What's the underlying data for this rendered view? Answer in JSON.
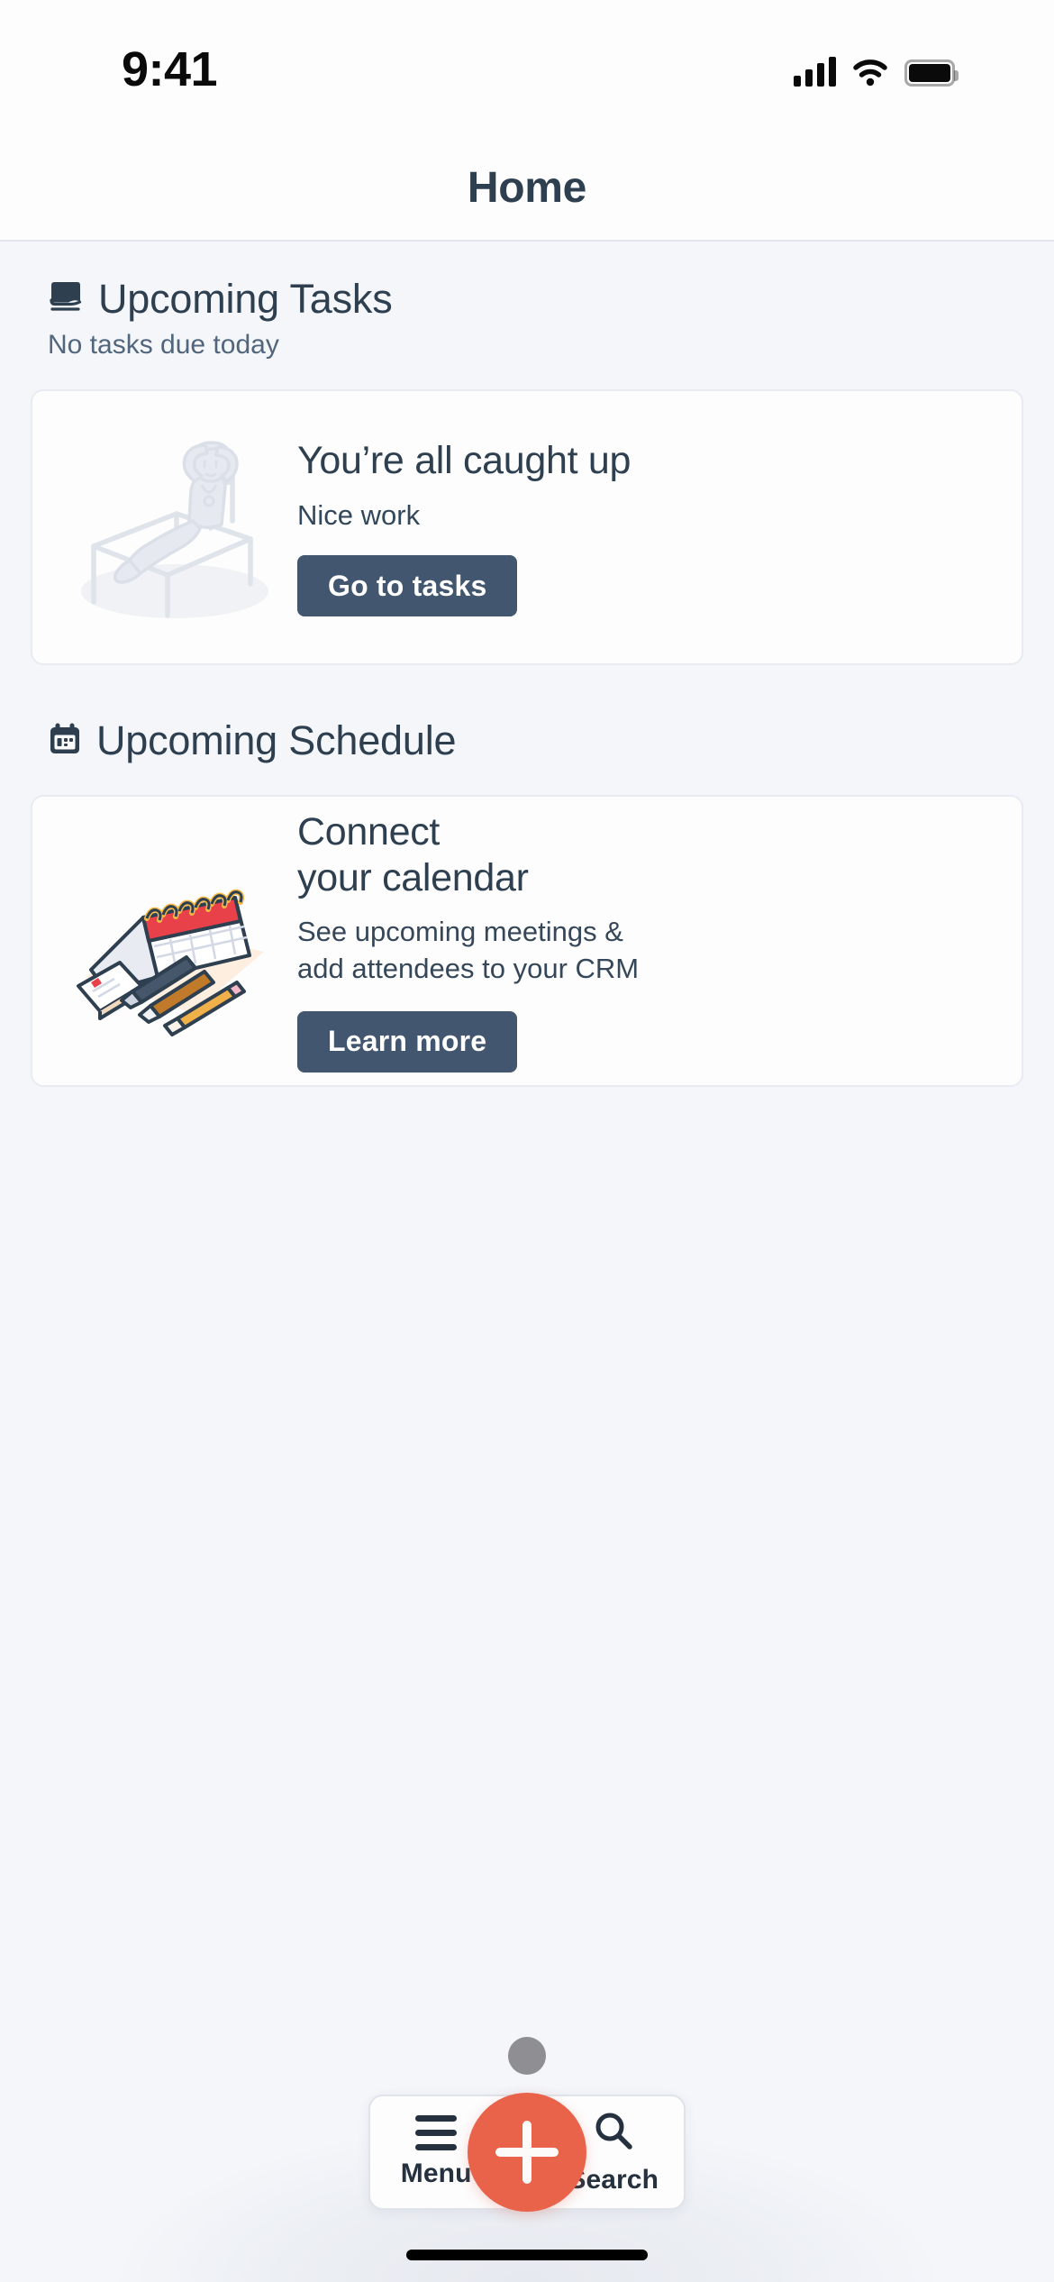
{
  "status_bar": {
    "time": "9:41",
    "signal_icon": "cellular-bars-icon",
    "wifi_icon": "wifi-icon",
    "battery_icon": "battery-full-icon"
  },
  "header": {
    "title": "Home"
  },
  "sections": [
    {
      "id": "upcoming-tasks",
      "icon": "notebook-icon",
      "title": "Upcoming Tasks",
      "subtitle": "No tasks due today",
      "card": {
        "illustration": "person-relaxing-on-lounger-illustration",
        "title": "You’re all caught up",
        "subtitle": "Nice work",
        "button_label": "Go to tasks"
      }
    },
    {
      "id": "upcoming-schedule",
      "icon": "calendar-icon",
      "title": "Upcoming Schedule",
      "subtitle": "",
      "card": {
        "illustration": "desk-calendar-with-pens-illustration",
        "title_line1": "Connect",
        "title_line2": "your calendar",
        "desc_line1": "See upcoming meetings &",
        "desc_line2": "add attendees to your CRM",
        "button_label": "Learn more"
      }
    }
  ],
  "bottom_bar": {
    "drag_handle": "drag-handle-dot",
    "menu": {
      "icon": "hamburger-menu-icon",
      "label": "Menu"
    },
    "create": {
      "icon": "plus-icon",
      "label": ""
    },
    "search": {
      "icon": "search-icon",
      "label": "Search"
    }
  },
  "colors": {
    "page_background": "#f4f6fa",
    "surface": "#fdfdfe",
    "text_primary": "#2e3f50",
    "text_secondary": "#51667c",
    "button_primary": "#42566f",
    "accent_fab": "#e8634a",
    "calendar_red": "#e8414a",
    "calendar_yellow": "#f5b944"
  }
}
